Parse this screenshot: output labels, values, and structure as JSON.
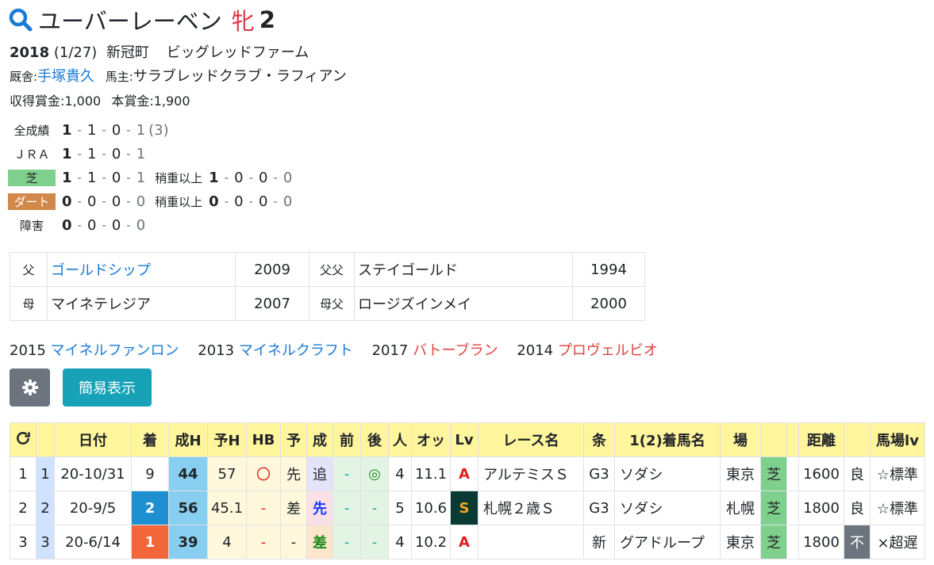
{
  "horse": {
    "name": "ユーバーレーベン",
    "sex": "牝",
    "age": "2"
  },
  "birth": {
    "year": "2018",
    "date": "(1/27)",
    "place": "新冠町",
    "breeder": "ビッグレッドファーム"
  },
  "stable": {
    "label": "厩舎:",
    "trainer": "手塚貴久",
    "owner_label": "馬主:",
    "owner": "サラブレッドクラブ・ラフィアン"
  },
  "prize": {
    "earned_label": "収得賞金:",
    "earned": "1,000",
    "main_label": "本賞金:",
    "main": "1,900"
  },
  "records": [
    {
      "label": "全成績",
      "v": [
        "1",
        "1",
        "0",
        "1"
      ],
      "extra": "(3)"
    },
    {
      "label": "ＪＲＡ",
      "v": [
        "1",
        "1",
        "0",
        "1"
      ]
    },
    {
      "label": "芝",
      "v": [
        "1",
        "1",
        "0",
        "1"
      ],
      "sub_label": "稍重以上",
      "sub": [
        "1",
        "0",
        "0",
        "0"
      ]
    },
    {
      "label": "ダート",
      "v": [
        "0",
        "0",
        "0",
        "0"
      ],
      "sub_label": "稍重以上",
      "sub": [
        "0",
        "0",
        "0",
        "0"
      ]
    },
    {
      "label": "障害",
      "v": [
        "0",
        "0",
        "0",
        "0"
      ]
    }
  ],
  "pedigree": {
    "sire_label": "父",
    "sire": "ゴールドシップ",
    "sire_year": "2009",
    "sire_sire_label": "父父",
    "sire_sire": "ステイゴールド",
    "sire_sire_year": "1994",
    "dam_label": "母",
    "dam": "マイネテレジア",
    "dam_year": "2007",
    "dam_sire_label": "母父",
    "dam_sire": "ロージズインメイ",
    "dam_sire_year": "2000"
  },
  "siblings": [
    {
      "year": "2015",
      "name": "マイネルファンロン",
      "color": "blue"
    },
    {
      "year": "2013",
      "name": "マイネルクラフト",
      "color": "blue"
    },
    {
      "year": "2017",
      "name": "バトーブラン",
      "color": "red"
    },
    {
      "year": "2014",
      "name": "プロヴェルビオ",
      "color": "red"
    }
  ],
  "buttons": {
    "settings_icon": "gear-icon",
    "simple": "簡易表示"
  },
  "table": {
    "headers": [
      "日付",
      "着",
      "成H",
      "予H",
      "HB",
      "予",
      "成",
      "前",
      "後",
      "人",
      "オッ",
      "Lv",
      "レース名",
      "条",
      "1(2)着馬名",
      "場",
      "",
      "距離",
      "",
      "馬場lv"
    ],
    "rows": [
      {
        "n": "1",
        "lbl": "1",
        "date": "20-10/31",
        "rank": "9",
        "sh": "44",
        "yh": "57",
        "hb": "〇",
        "yo": "先",
        "sei": "追",
        "mae": "-",
        "ato": "◎",
        "nin": "4",
        "odds": "11.1",
        "lv": "A",
        "race": "アルテミスＳ",
        "jou": "G3",
        "winner": "ソダシ",
        "place": "東京",
        "surf": "芝",
        "dist": "1600",
        "cond": "良",
        "baba": "☆標準"
      },
      {
        "n": "2",
        "lbl": "2",
        "date": "20-9/5",
        "rank": "2",
        "sh": "56",
        "yh": "45.1",
        "hb": "-",
        "yo": "差",
        "sei": "先",
        "mae": "-",
        "ato": "-",
        "nin": "5",
        "odds": "10.6",
        "lv": "S",
        "race": "札幌２歳Ｓ",
        "jou": "G3",
        "winner": "ソダシ",
        "place": "札幌",
        "surf": "芝",
        "dist": "1800",
        "cond": "良",
        "baba": "☆標準"
      },
      {
        "n": "3",
        "lbl": "3",
        "date": "20-6/14",
        "rank": "1",
        "sh": "39",
        "yh": "4",
        "hb": "-",
        "yo": "-",
        "sei": "差",
        "mae": "-",
        "ato": "-",
        "nin": "4",
        "odds": "10.2",
        "lv": "A",
        "race": "",
        "jou": "新",
        "winner": "グアドループ",
        "place": "東京",
        "surf": "芝",
        "dist": "1800",
        "cond": "不",
        "baba": "×超遅"
      }
    ]
  }
}
